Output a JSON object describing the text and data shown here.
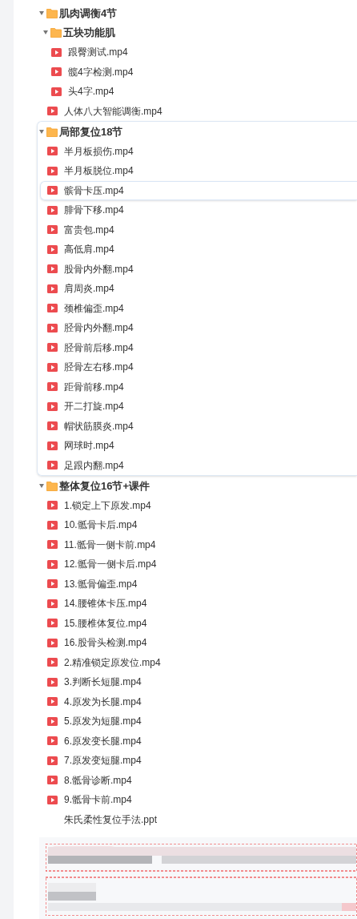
{
  "tree": [
    {
      "kind": "folder",
      "label": "肌肉调衡4节",
      "expanded": true,
      "highlighted": false,
      "children": [
        {
          "kind": "folder",
          "label": "五块功能肌",
          "expanded": true,
          "highlighted": false,
          "children": [
            {
              "kind": "video",
              "label": "跟臀测试.mp4",
              "selected": false
            },
            {
              "kind": "video",
              "label": "髋4字检测.mp4",
              "selected": false
            },
            {
              "kind": "video",
              "label": "头4字.mp4",
              "selected": false
            }
          ]
        },
        {
          "kind": "video",
          "label": "人体八大智能调衡.mp4",
          "selected": false
        }
      ]
    },
    {
      "kind": "folder",
      "label": "局部复位18节",
      "expanded": true,
      "highlighted": true,
      "children": [
        {
          "kind": "video",
          "label": "半月板损伤.mp4",
          "selected": false
        },
        {
          "kind": "video",
          "label": "半月板脱位.mp4",
          "selected": false
        },
        {
          "kind": "video",
          "label": "髌骨卡压.mp4",
          "selected": true
        },
        {
          "kind": "video",
          "label": "腓骨下移.mp4",
          "selected": false
        },
        {
          "kind": "video",
          "label": "富贵包.mp4",
          "selected": false
        },
        {
          "kind": "video",
          "label": "高低肩.mp4",
          "selected": false
        },
        {
          "kind": "video",
          "label": "股骨内外翻.mp4",
          "selected": false
        },
        {
          "kind": "video",
          "label": "肩周炎.mp4",
          "selected": false
        },
        {
          "kind": "video",
          "label": "颈椎偏歪.mp4",
          "selected": false
        },
        {
          "kind": "video",
          "label": "胫骨内外翻.mp4",
          "selected": false
        },
        {
          "kind": "video",
          "label": "胫骨前后移.mp4",
          "selected": false
        },
        {
          "kind": "video",
          "label": "胫骨左右移.mp4",
          "selected": false
        },
        {
          "kind": "video",
          "label": "距骨前移.mp4",
          "selected": false
        },
        {
          "kind": "video",
          "label": "开二打旋.mp4",
          "selected": false
        },
        {
          "kind": "video",
          "label": "帽状筋膜炎.mp4",
          "selected": false
        },
        {
          "kind": "video",
          "label": "网球时.mp4",
          "selected": false
        },
        {
          "kind": "video",
          "label": "足跟内翻.mp4",
          "selected": false
        }
      ]
    },
    {
      "kind": "folder",
      "label": "整体复位16节+课件",
      "expanded": true,
      "highlighted": false,
      "children": [
        {
          "kind": "video",
          "label": "1.锁定上下原发.mp4",
          "selected": false
        },
        {
          "kind": "video",
          "label": "10.骶骨卡后.mp4",
          "selected": false
        },
        {
          "kind": "video",
          "label": "11.骶骨一侧卡前.mp4",
          "selected": false
        },
        {
          "kind": "video",
          "label": "12.骶骨一侧卡后.mp4",
          "selected": false
        },
        {
          "kind": "video",
          "label": "13.骶骨偏歪.mp4",
          "selected": false
        },
        {
          "kind": "video",
          "label": "14.腰锥体卡压.mp4",
          "selected": false
        },
        {
          "kind": "video",
          "label": "15.腰椎体复位.mp4",
          "selected": false
        },
        {
          "kind": "video",
          "label": "16.股骨头检测.mp4",
          "selected": false
        },
        {
          "kind": "video",
          "label": "2.精准锁定原发位.mp4",
          "selected": false
        },
        {
          "kind": "video",
          "label": "3.判断长短腿.mp4",
          "selected": false
        },
        {
          "kind": "video",
          "label": "4.原发为长腿.mp4",
          "selected": false
        },
        {
          "kind": "video",
          "label": "5.原发为短腿.mp4",
          "selected": false
        },
        {
          "kind": "video",
          "label": "6.原发变长腿.mp4",
          "selected": false
        },
        {
          "kind": "video",
          "label": "7.原发变短腿.mp4",
          "selected": false
        },
        {
          "kind": "video",
          "label": "8.骶骨诊断.mp4",
          "selected": false
        },
        {
          "kind": "video",
          "label": "9.骶骨卡前.mp4",
          "selected": false
        },
        {
          "kind": "file",
          "label": "朱氏柔性复位手法.ppt",
          "selected": false
        }
      ]
    }
  ]
}
